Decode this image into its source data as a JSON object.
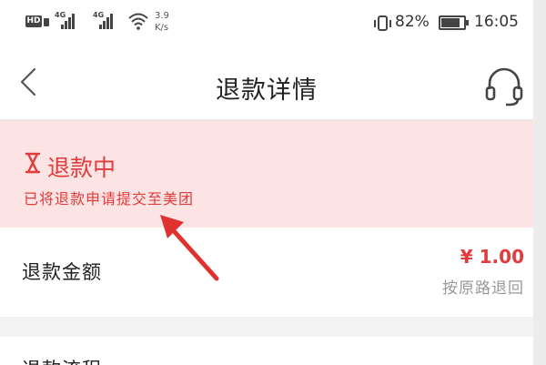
{
  "status_bar": {
    "hd": "HD",
    "network_1": "4G",
    "network_2": "4G",
    "speed_value": "3.9",
    "speed_unit": "K/s",
    "battery_percent": "82%",
    "battery_level": 0.82,
    "time": "16:05"
  },
  "header": {
    "title": "退款详情",
    "back_icon": "chevron-left-icon",
    "service_icon": "headset-icon"
  },
  "refund_status": {
    "icon": "hourglass-icon",
    "title": "退款中",
    "description": "已将退款申请提交至美团"
  },
  "refund_amount": {
    "label": "退款金额",
    "value": "¥ 1.00",
    "method": "按原路退回"
  },
  "refund_process": {
    "label": "退款流程"
  },
  "colors": {
    "accent_red": "#e23b3b",
    "banner_bg": "#fce4e4",
    "annotation_arrow": "#e03131"
  }
}
